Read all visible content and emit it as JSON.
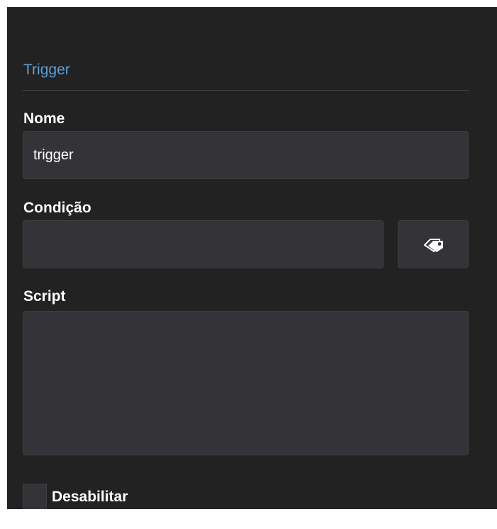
{
  "section": {
    "title": "Trigger"
  },
  "fields": {
    "nome": {
      "label": "Nome",
      "value": "trigger",
      "placeholder": ""
    },
    "condicao": {
      "label": "Condição",
      "value": "",
      "placeholder": "",
      "button_icon": "tags-icon"
    },
    "script": {
      "label": "Script",
      "value": "",
      "placeholder": ""
    }
  },
  "checkbox": {
    "label": "Desabilitar",
    "checked": false
  },
  "colors": {
    "panel_background": "#222222",
    "field_background": "#333338",
    "accent": "#5b9fd6",
    "text": "#ffffff"
  }
}
